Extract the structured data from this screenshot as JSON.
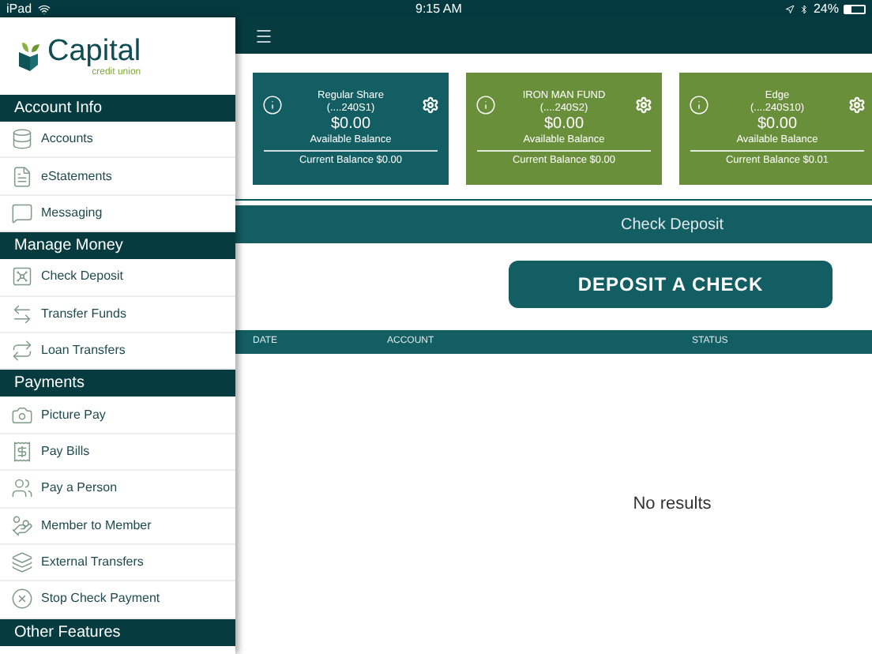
{
  "status_bar": {
    "device": "iPad",
    "time": "9:15 AM",
    "battery": "24%"
  },
  "sidebar": {
    "logo": {
      "name": "Capital",
      "tagline": "credit union"
    },
    "sections": [
      {
        "title": "Account Info",
        "items": [
          {
            "label": "Accounts",
            "kind": "accounts"
          },
          {
            "label": "eStatements",
            "kind": "statements"
          },
          {
            "label": "Messaging",
            "kind": "messaging"
          }
        ]
      },
      {
        "title": "Manage Money",
        "items": [
          {
            "label": "Check Deposit",
            "kind": "deposit"
          },
          {
            "label": "Transfer Funds",
            "kind": "transfer"
          },
          {
            "label": "Loan Transfers",
            "kind": "loan"
          }
        ]
      },
      {
        "title": "Payments",
        "items": [
          {
            "label": "Picture Pay",
            "kind": "camera"
          },
          {
            "label": "Pay Bills",
            "kind": "bills"
          },
          {
            "label": "Pay a Person",
            "kind": "person"
          },
          {
            "label": "Member to Member",
            "kind": "member"
          },
          {
            "label": "External Transfers",
            "kind": "external"
          },
          {
            "label": "Stop Check Payment",
            "kind": "stop"
          }
        ]
      },
      {
        "title": "Other Features"
      }
    ]
  },
  "accounts": [
    {
      "name": "Regular Share",
      "number": "(....240S1)",
      "available": "$0.00",
      "available_label": "Available Balance",
      "current": "Current Balance $0.00",
      "selected": true
    },
    {
      "name": "IRON MAN FUND",
      "number": "(....240S2)",
      "available": "$0.00",
      "available_label": "Available Balance",
      "current": "Current Balance $0.00",
      "selected": false
    },
    {
      "name": "Edge",
      "number": "(....240S10)",
      "available": "$0.00",
      "available_label": "Available Balance",
      "current": "Current Balance $0.01",
      "selected": false
    }
  ],
  "section_title": "Check Deposit",
  "deposit_button": "DEPOSIT A CHECK",
  "table": {
    "columns": [
      "DATE",
      "ACCOUNT",
      "STATUS"
    ],
    "empty_message": "No results"
  }
}
